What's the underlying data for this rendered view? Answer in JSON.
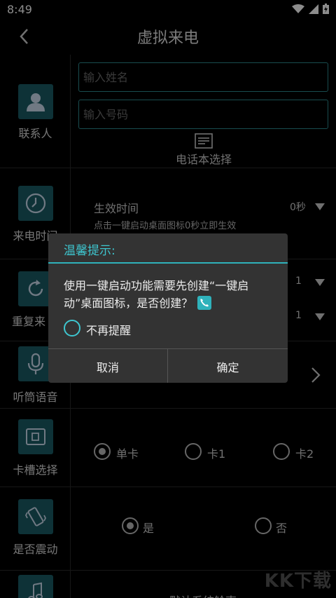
{
  "status": {
    "time": "8:49"
  },
  "header": {
    "title": "虚拟来电"
  },
  "contact": {
    "label": "联系人",
    "name_placeholder": "输入姓名",
    "number_placeholder": "输入号码",
    "phonebook_label": "电话本选择"
  },
  "call_time": {
    "label": "来电时间",
    "effective_label": "生效时间",
    "value": "0秒",
    "hint": "点击一键启动桌面图标0秒立即生效"
  },
  "repeat": {
    "label": "重复来",
    "value1": "1",
    "value2": "1"
  },
  "earpiece": {
    "label": "听筒语音"
  },
  "sim": {
    "label": "卡槽选择",
    "options": [
      "单卡",
      "卡1",
      "卡2"
    ],
    "selected": "单卡"
  },
  "vibrate": {
    "label": "是否震动",
    "options": [
      "是",
      "否"
    ],
    "selected": "是"
  },
  "ringtone": {
    "value": "默认系统铃声"
  },
  "dialog": {
    "title": "温馨提示:",
    "message": "使用一键启动功能需要先创建“一键启动”桌面图标，是否创建？",
    "checkbox_label": "不再提醒",
    "cancel": "取消",
    "confirm": "确定"
  },
  "watermark": "KK下载"
}
